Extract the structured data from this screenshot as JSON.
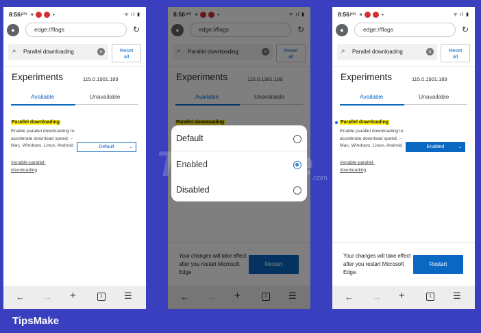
{
  "status": {
    "time": "8:56",
    "ampm": "pm"
  },
  "browser": {
    "url": "edge://flags"
  },
  "search": {
    "value": "Parallel downloading",
    "reset_label_1": "Reset",
    "reset_label_2": "all"
  },
  "page": {
    "title": "Experiments",
    "version": "115.0.1901.189"
  },
  "tabs": {
    "available": "Available",
    "unavailable": "Unavailable"
  },
  "flag": {
    "name": "Parallel downloading",
    "description": "Enable parallel downloading to accelerate download speed. – Mac, Windows, Linux, Android",
    "link": "#enable-parallel-downloading"
  },
  "select_values": {
    "phone1": "Default",
    "phone3": "Enabled"
  },
  "dialog_options": [
    "Default",
    "Enabled",
    "Disabled"
  ],
  "dialog_selected": "Enabled",
  "restart": {
    "message": "Your changes will take effect after you restart Microsoft Edge.",
    "button": "Restart"
  },
  "watermark": {
    "text": "TipsMake",
    "suffix": ".com"
  },
  "brand": "TipsMake",
  "colors": {
    "accent": "#0a67c2",
    "frame": "#3a3fbf",
    "highlight": "#fff200"
  }
}
